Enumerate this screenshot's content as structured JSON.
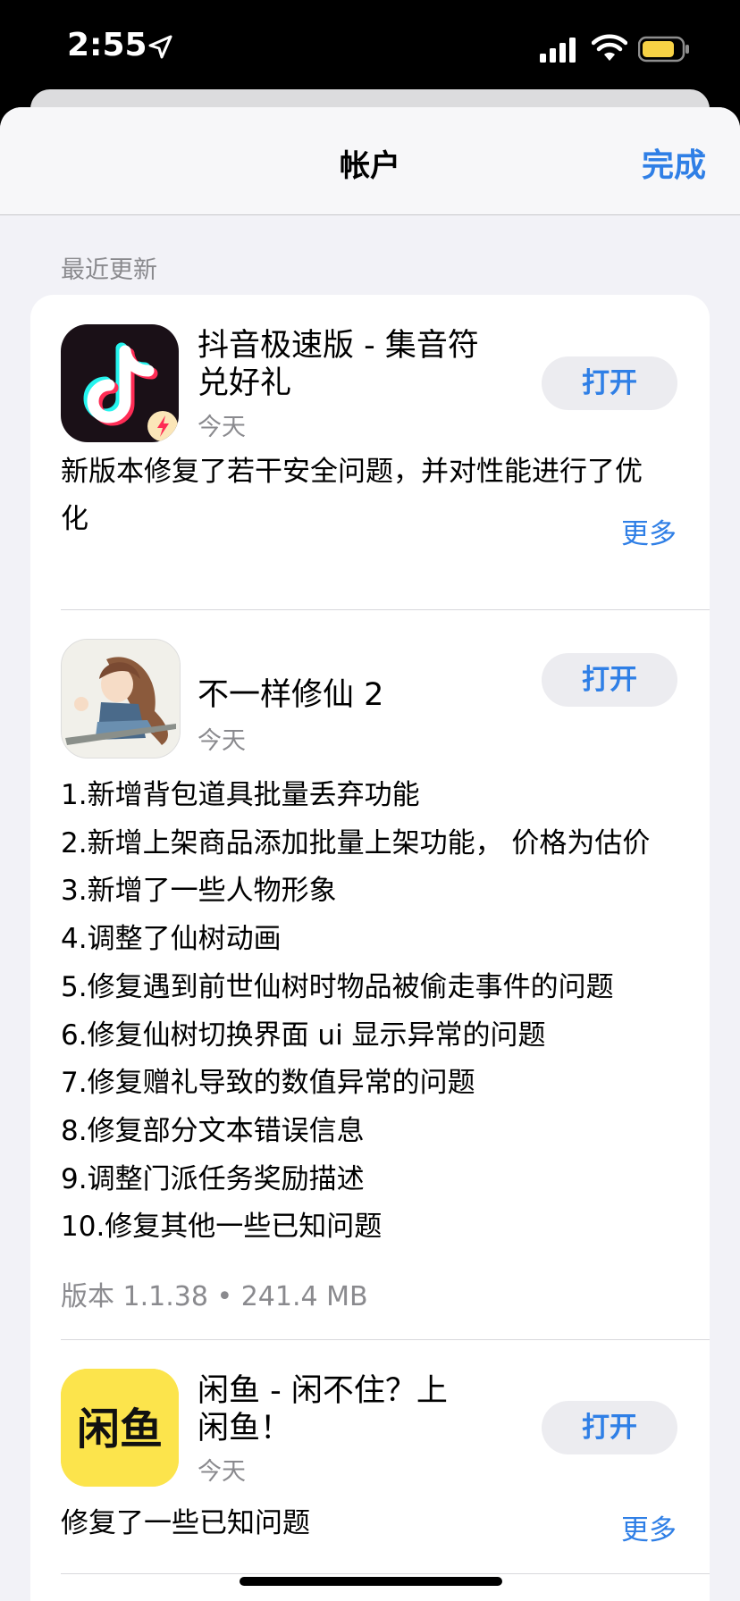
{
  "status_bar": {
    "time": "2:55"
  },
  "nav": {
    "title": "帐户",
    "done_label": "完成"
  },
  "section_header": "最近更新",
  "apps": [
    {
      "name_line1": "抖音极速版 - 集音符",
      "name_line2": "兑好礼",
      "date": "今天",
      "button": "打开",
      "notes_line1": "新版本修复了若干安全问题，并对性能进行了优",
      "notes_line2": "化",
      "more": "更多"
    },
    {
      "name": "不一样修仙 2",
      "date": "今天",
      "button": "打开",
      "notes": [
        "1.新增背包道具批量丢弃功能",
        "2.新增上架商品添加批量上架功能， 价格为估价",
        "3.新增了一些人物形象",
        "4.调整了仙树动画",
        "5.修复遇到前世仙树时物品被偷走事件的问题",
        "6.修复仙树切换界面 ui 显示异常的问题",
        "7.修复赠礼导致的数值异常的问题",
        "8.修复部分文本错误信息",
        "9.调整门派任务奖励描述",
        "10.修复其他一些已知问题"
      ],
      "version": "版本 1.1.38 • 241.4 MB"
    },
    {
      "name_line1": "闲鱼 - 闲不住？上",
      "name_line2": "闲鱼！",
      "date": "今天",
      "button": "打开",
      "icon_text": "闲鱼",
      "notes": "修复了一些已知问题",
      "more": "更多"
    }
  ],
  "colors": {
    "accent": "#2f7fe6",
    "secondary_text": "#8a8a8e",
    "icon_yellow": "#fce44c",
    "tiktok_bg": "#1a1017"
  }
}
